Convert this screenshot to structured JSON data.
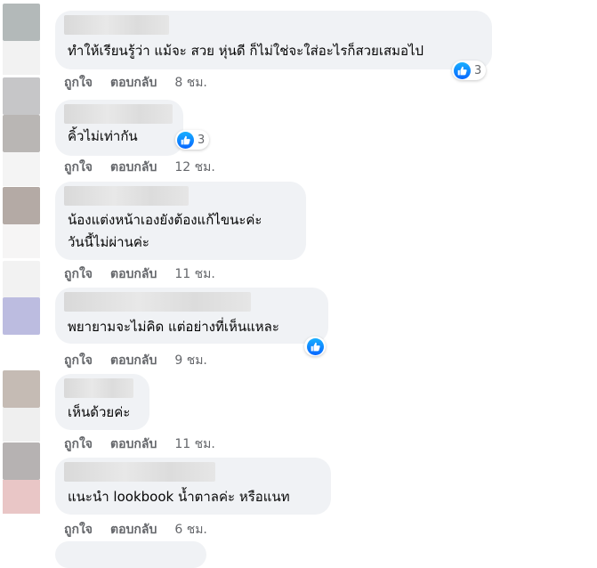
{
  "comments": [
    {
      "text_lines": [
        "ทำให้เรียนรู้ว่า แม้จะ สวย หุ่นดี ก็ไม่ใช่จะใส่อะไรก็สวยเสมอไป"
      ],
      "reactions": "3",
      "time": "8 ชม."
    },
    {
      "text_lines": [
        "คิ้วไม่เท่ากัน"
      ],
      "reactions": "3",
      "time": "12 ชม."
    },
    {
      "text_lines": [
        "น้องแต่งหน้าเองยังต้องแก้ไขนะค่ะ",
        "วันนี้ไม่ผ่านค่ะ"
      ],
      "reactions": "",
      "time": "11 ชม."
    },
    {
      "text_lines": [
        "พยายามจะไม่คิด แต่อย่างที่เห็นแหละ"
      ],
      "reactions": "",
      "time": "9 ชม."
    },
    {
      "text_lines": [
        "เห็นด้วยค่ะ"
      ],
      "reactions": "",
      "time": "11 ชม."
    },
    {
      "text_lines": [
        "แนะนำ lookbook น้ำตาลค่ะ หรือแนท"
      ],
      "reactions": "",
      "time": "6 ชม."
    }
  ],
  "actions": {
    "like_label": "ถูกใจ",
    "reply_label": "ตอบกลับ"
  },
  "icons": {
    "reaction": "like-thumb-icon"
  },
  "colors": {
    "bubble": "#f0f2f5",
    "action_text": "#65676b",
    "like_blue": "#0866ff"
  }
}
